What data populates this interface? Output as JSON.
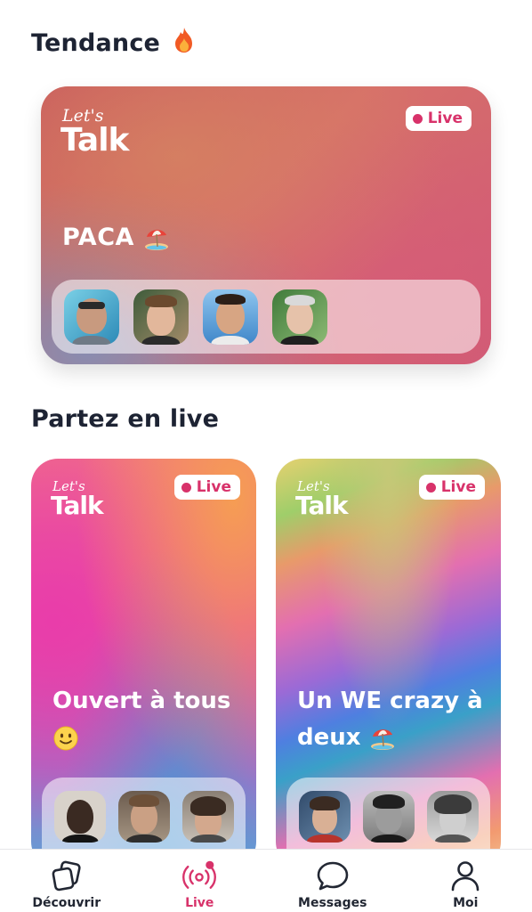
{
  "sections": {
    "trending_title": "Tendance",
    "live_title": "Partez en live"
  },
  "brand": {
    "lets": "Let's",
    "talk": "Talk"
  },
  "live_badge": "Live",
  "trending_room": {
    "title": "PACA",
    "participants": 4
  },
  "live_rooms": [
    {
      "title": "Ouvert à tous",
      "participants": 3
    },
    {
      "title": "Un WE crazy à deux",
      "participants": 3
    }
  ],
  "bottom_nav": {
    "items": [
      {
        "label": "Découvrir",
        "icon": "cards-icon"
      },
      {
        "label": "Live",
        "icon": "broadcast-icon",
        "active": true
      },
      {
        "label": "Messages",
        "icon": "chat-bubble-icon"
      },
      {
        "label": "Moi",
        "icon": "user-icon"
      }
    ]
  },
  "colors": {
    "accent": "#d8326a",
    "text": "#1d2333"
  }
}
